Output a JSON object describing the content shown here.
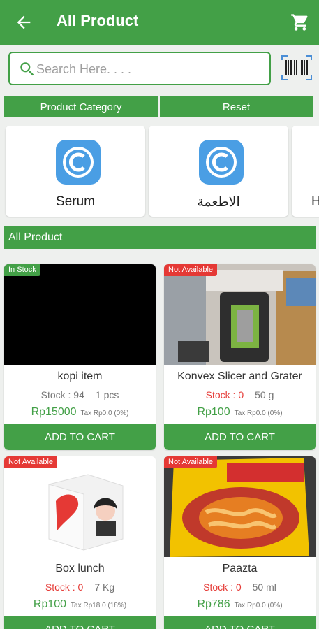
{
  "header": {
    "title": "All Product",
    "back_icon": "arrow-back-icon",
    "cart_icon": "shopping-cart-icon"
  },
  "search": {
    "placeholder": "Search Here. . . .",
    "value": ""
  },
  "buttons": {
    "category": "Product Category",
    "reset": "Reset"
  },
  "categories": [
    {
      "label": "Serum",
      "icon": "category-c-icon"
    },
    {
      "label": "الاطعمة",
      "icon": "category-c-icon"
    },
    {
      "label": "H",
      "icon": "category-c-icon"
    }
  ],
  "section_title": "All Product",
  "products": [
    {
      "badge": "In Stock",
      "name": "kopi item",
      "stock": "Stock : 94",
      "unit": "1 pcs",
      "price": "Rp15000",
      "tax": "Tax Rp0.0 (0%)",
      "add": "ADD TO CART"
    },
    {
      "badge": "Not Available",
      "name": "Konvex Slicer and Grater",
      "stock": "Stock : 0",
      "unit": "50 g",
      "price": "Rp100",
      "tax": "Tax Rp0.0 (0%)",
      "add": "ADD TO CART"
    },
    {
      "badge": "Not Available",
      "name": "Box lunch",
      "stock": "Stock : 0",
      "unit": "7 Kg",
      "price": "Rp100",
      "tax": "Tax Rp18.0 (18%)",
      "add": "ADD TO CART"
    },
    {
      "badge": "Not Available",
      "name": "Paazta",
      "stock": "Stock : 0",
      "unit": "50 ml",
      "price": "Rp786",
      "tax": "Tax Rp0.0 (0%)",
      "add": "ADD TO CART"
    }
  ],
  "colors": {
    "primary": "#43a047",
    "danger": "#e53935",
    "background": "#eef0ee"
  }
}
